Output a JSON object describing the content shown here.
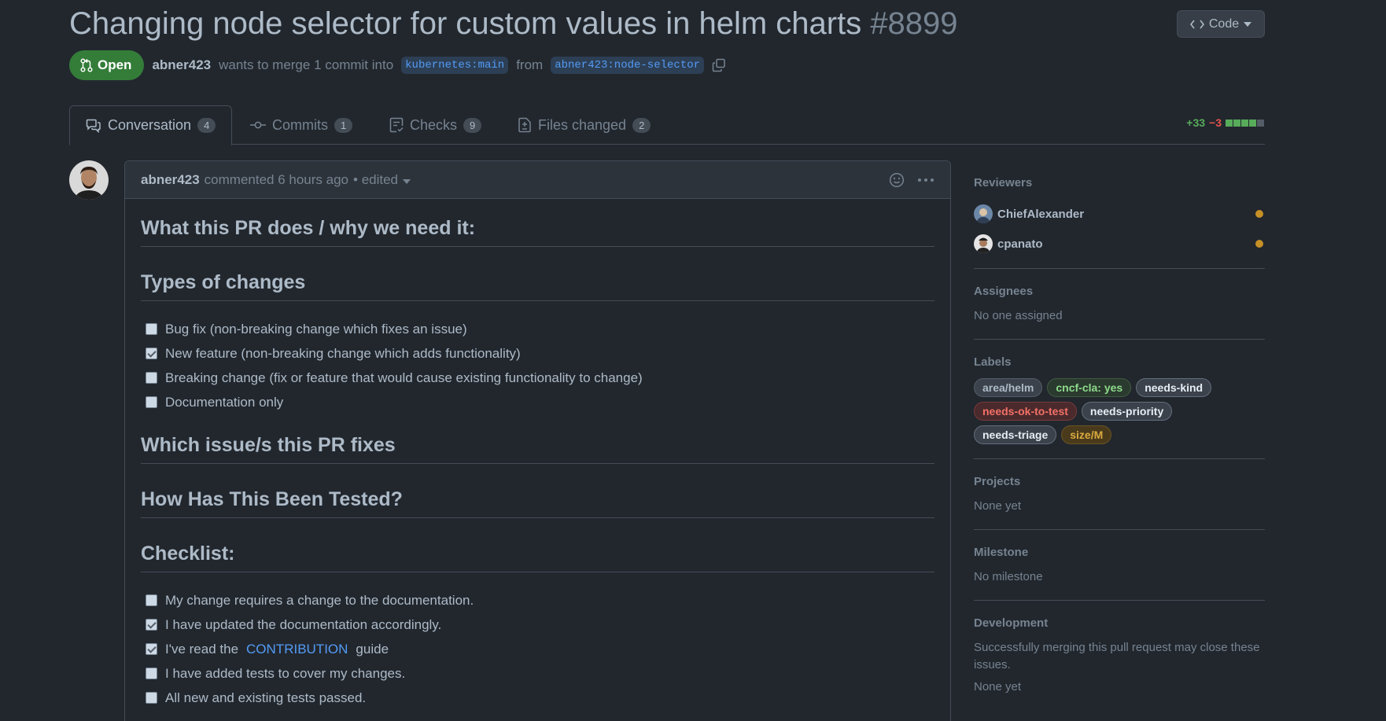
{
  "pr": {
    "title": "Changing node selector for custom values in helm charts",
    "number": "#8899",
    "state": "Open",
    "author": "abner423",
    "merge_text": "wants to merge 1 commit into",
    "base_branch": "kubernetes:main",
    "from_text": "from",
    "head_branch": "abner423:node-selector"
  },
  "code_button": "Code",
  "tabs": [
    {
      "label": "Conversation",
      "count": "4"
    },
    {
      "label": "Commits",
      "count": "1"
    },
    {
      "label": "Checks",
      "count": "9"
    },
    {
      "label": "Files changed",
      "count": "2"
    }
  ],
  "diffstat": {
    "additions": "+33",
    "deletions": "−3"
  },
  "comment": {
    "author": "abner423",
    "meta": "commented 6 hours ago",
    "edited": "• edited",
    "h_what": "What this PR does / why we need it:",
    "h_types": "Types of changes",
    "types": [
      {
        "text": "Bug fix (non-breaking change which fixes an issue)",
        "checked": false
      },
      {
        "text": "New feature (non-breaking change which adds functionality)",
        "checked": true
      },
      {
        "text": "Breaking change (fix or feature that would cause existing functionality to change)",
        "checked": false
      },
      {
        "text": "Documentation only",
        "checked": false
      }
    ],
    "h_issue": "Which issue/s this PR fixes",
    "h_tested": "How Has This Been Tested?",
    "h_checklist": "Checklist:",
    "checklist": [
      {
        "text": "My change requires a change to the documentation.",
        "checked": false
      },
      {
        "text": "I have updated the documentation accordingly.",
        "checked": true
      },
      {
        "text": "I've read the",
        "link": "CONTRIBUTION",
        "after": "guide",
        "checked": true
      },
      {
        "text": "I have added tests to cover my changes.",
        "checked": false
      },
      {
        "text": "All new and existing tests passed.",
        "checked": false
      }
    ]
  },
  "sidebar": {
    "reviewers_title": "Reviewers",
    "reviewers": [
      "ChiefAlexander",
      "cpanato"
    ],
    "assignees_title": "Assignees",
    "assignees_text": "No one assigned",
    "labels_title": "Labels",
    "labels": [
      {
        "text": "area/helm",
        "color": "#adbac7",
        "bg": "#3b424b",
        "border": "#545d68"
      },
      {
        "text": "cncf-cla: yes",
        "color": "#8ddb8c",
        "bg": "#2b3a2e",
        "border": "#3f5a40"
      },
      {
        "text": "needs-kind",
        "color": "#e6edf3",
        "bg": "#3b424b",
        "border": "#636e7b"
      },
      {
        "text": "needs-ok-to-test",
        "color": "#f47067",
        "bg": "#4a2a2c",
        "border": "#7a3a3a"
      },
      {
        "text": "needs-priority",
        "color": "#e6edf3",
        "bg": "#3b424b",
        "border": "#636e7b"
      },
      {
        "text": "needs-triage",
        "color": "#e6edf3",
        "bg": "#3b424b",
        "border": "#636e7b"
      },
      {
        "text": "size/M",
        "color": "#daaa3f",
        "bg": "#4a3a1c",
        "border": "#6a5423"
      }
    ],
    "projects_title": "Projects",
    "projects_text": "None yet",
    "milestone_title": "Milestone",
    "milestone_text": "No milestone",
    "development_title": "Development",
    "development_text": "Successfully merging this pull request may close these issues.",
    "development_more": "None yet"
  }
}
